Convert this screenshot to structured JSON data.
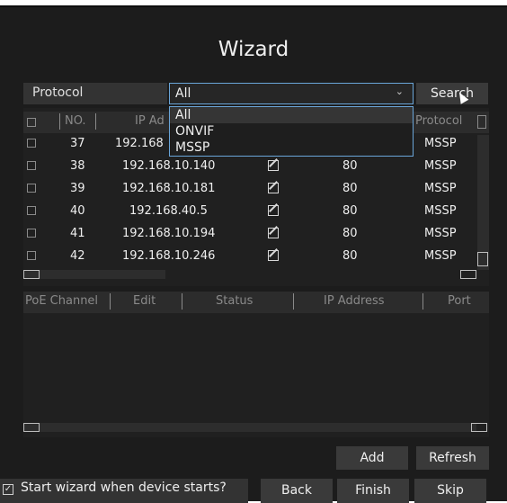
{
  "title": "Wizard",
  "protocol": {
    "label": "Protocol",
    "selected": "All",
    "options": [
      "All",
      "ONVIF",
      "MSSP"
    ]
  },
  "search_label": "Search",
  "device_table": {
    "headers": [
      "NO.",
      "IP Ad",
      "Protocol"
    ],
    "rows": [
      {
        "no": "37",
        "ip": "192.168",
        "port": "",
        "protocol": "MSSP"
      },
      {
        "no": "38",
        "ip": "192.168.10.140",
        "port": "80",
        "protocol": "MSSP"
      },
      {
        "no": "39",
        "ip": "192.168.10.181",
        "port": "80",
        "protocol": "MSSP"
      },
      {
        "no": "40",
        "ip": "192.168.40.5",
        "port": "80",
        "protocol": "MSSP"
      },
      {
        "no": "41",
        "ip": "192.168.10.194",
        "port": "80",
        "protocol": "MSSP"
      },
      {
        "no": "42",
        "ip": "192.168.10.246",
        "port": "80",
        "protocol": "MSSP"
      }
    ]
  },
  "poe_table": {
    "headers": [
      "PoE Channel",
      "Edit",
      "Status",
      "IP Address",
      "Port"
    ]
  },
  "buttons": {
    "add": "Add",
    "refresh": "Refresh",
    "back": "Back",
    "finish": "Finish",
    "skip": "Skip"
  },
  "start_wizard": {
    "label": "Start wizard when device starts?",
    "checked": true,
    "check_glyph": "✓"
  },
  "icons": [
    "edit-icon",
    "checkbox-icon",
    "chevron-down-icon",
    "cursor-icon"
  ],
  "colors": {
    "background": "#1c1c1c",
    "focus_border": "#6aa5d8"
  }
}
